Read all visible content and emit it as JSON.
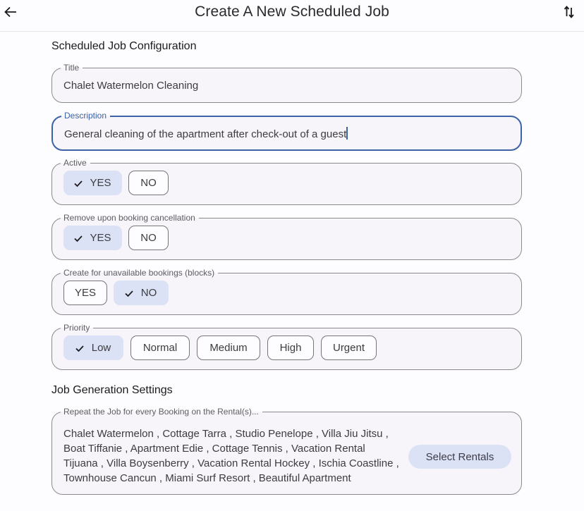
{
  "appbar": {
    "title": "Create A New Scheduled Job",
    "back_icon": "arrow-left-icon",
    "sort_icon": "swap-vertical-icon"
  },
  "sections": {
    "config_title": "Scheduled Job Configuration",
    "generation_title": "Job Generation Settings"
  },
  "fields": {
    "title": {
      "label": "Title",
      "value": "Chalet Watermelon Cleaning"
    },
    "description": {
      "label": "Description",
      "value": "General cleaning of the apartment after check-out of a guest",
      "focused": true
    }
  },
  "toggles": {
    "active": {
      "label": "Active",
      "options": [
        "YES",
        "NO"
      ],
      "selected": "YES"
    },
    "remove_on_cancel": {
      "label": "Remove upon booking cancellation",
      "options": [
        "YES",
        "NO"
      ],
      "selected": "YES"
    },
    "create_for_blocks": {
      "label": "Create for unavailable bookings (blocks)",
      "options": [
        "YES",
        "NO"
      ],
      "selected": "NO"
    },
    "priority": {
      "label": "Priority",
      "options": [
        "Low",
        "Normal",
        "Medium",
        "High",
        "Urgent"
      ],
      "selected": "Low"
    }
  },
  "rentals": {
    "label": "Repeat the Job for every Booking on the Rental(s)...",
    "text": "Chalet Watermelon , Cottage Tarra , Studio Penelope , Villa Jiu Jitsu , Boat Tiffanie , Apartment Edie , Cottage Tennis , Vacation Rental Tijuana , Villa Boysenberry , Vacation Rental Hockey , Ischia Coastline , Townhouse Cancun , Miami Surf Resort , Beautiful Apartment",
    "items": [
      "Chalet Watermelon",
      "Cottage Tarra",
      "Studio Penelope",
      "Villa Jiu Jitsu",
      "Boat Tiffanie",
      "Apartment Edie",
      "Cottage Tennis",
      "Vacation Rental Tijuana",
      "Villa Boysenberry",
      "Vacation Rental Hockey",
      "Ischia Coastline",
      "Townhouse Cancun",
      "Miami Surf Resort",
      "Beautiful Apartment"
    ],
    "button_label": "Select Rentals"
  },
  "colors": {
    "accent": "#3b63a6",
    "selected_chip": "#dce2f5",
    "field_bg": "#f7f5f9"
  }
}
